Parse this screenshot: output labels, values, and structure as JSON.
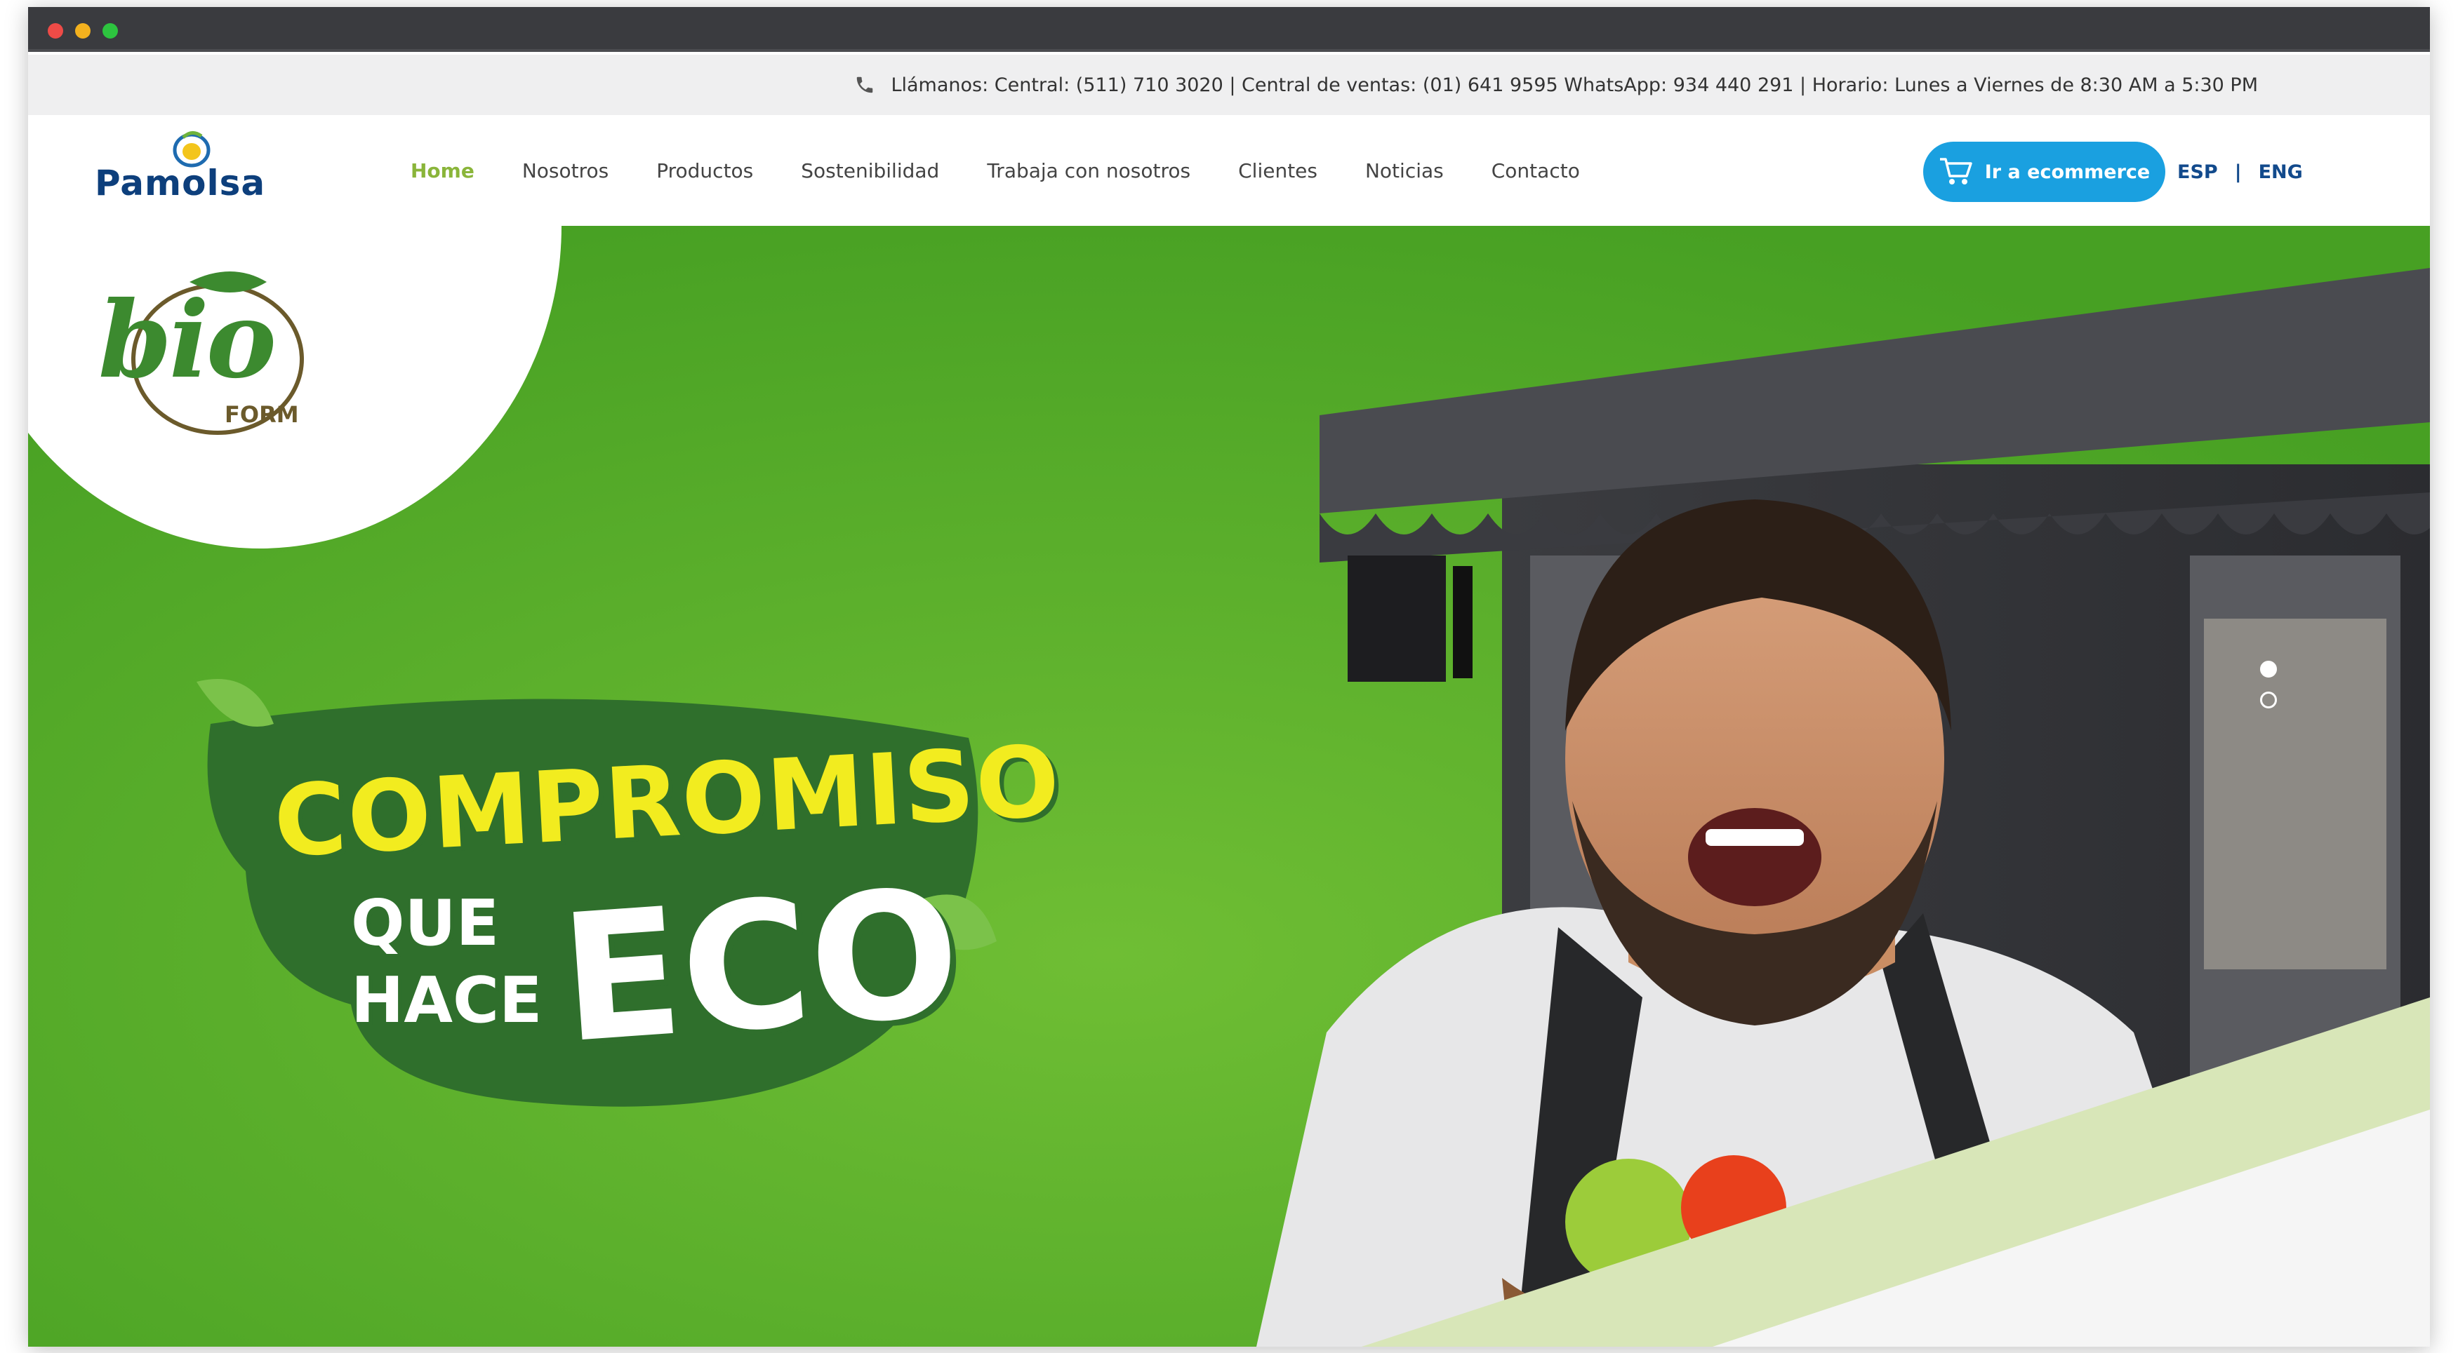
{
  "topbar": {
    "contact_line": "Llámanos: Central: (511) 710 3020 | Central de ventas: (01) 641 9595 WhatsApp: 934 440 291 | Horario: Lunes a Viernes de 8:30 AM a 5:30 PM"
  },
  "header": {
    "logo_text": "Pamolsa",
    "nav": [
      {
        "label": "Home",
        "active": true
      },
      {
        "label": "Nosotros"
      },
      {
        "label": "Productos"
      },
      {
        "label": "Sostenibilidad"
      },
      {
        "label": "Trabaja con nosotros"
      },
      {
        "label": "Clientes"
      },
      {
        "label": "Noticias"
      },
      {
        "label": "Contacto"
      }
    ],
    "ecommerce_label": "Ir a ecommerce",
    "lang_esp": "ESP",
    "lang_sep": "|",
    "lang_eng": "ENG"
  },
  "hero": {
    "brand_word": "bio",
    "brand_sub": "FORM",
    "headline_1": "COMPROMISO",
    "headline_2a": "QUE",
    "headline_2b": "HACE",
    "headline_3": "ECO",
    "slides_total": 2,
    "slide_active": 1
  },
  "colors": {
    "green": "#4fa82a",
    "accent_green": "#8ab53a",
    "blue": "#1aa0e0",
    "navy": "#0d3f7c"
  },
  "icons": [
    "phone-icon",
    "cart-icon",
    "pamolsa-logo-icon",
    "leaf-icon"
  ]
}
